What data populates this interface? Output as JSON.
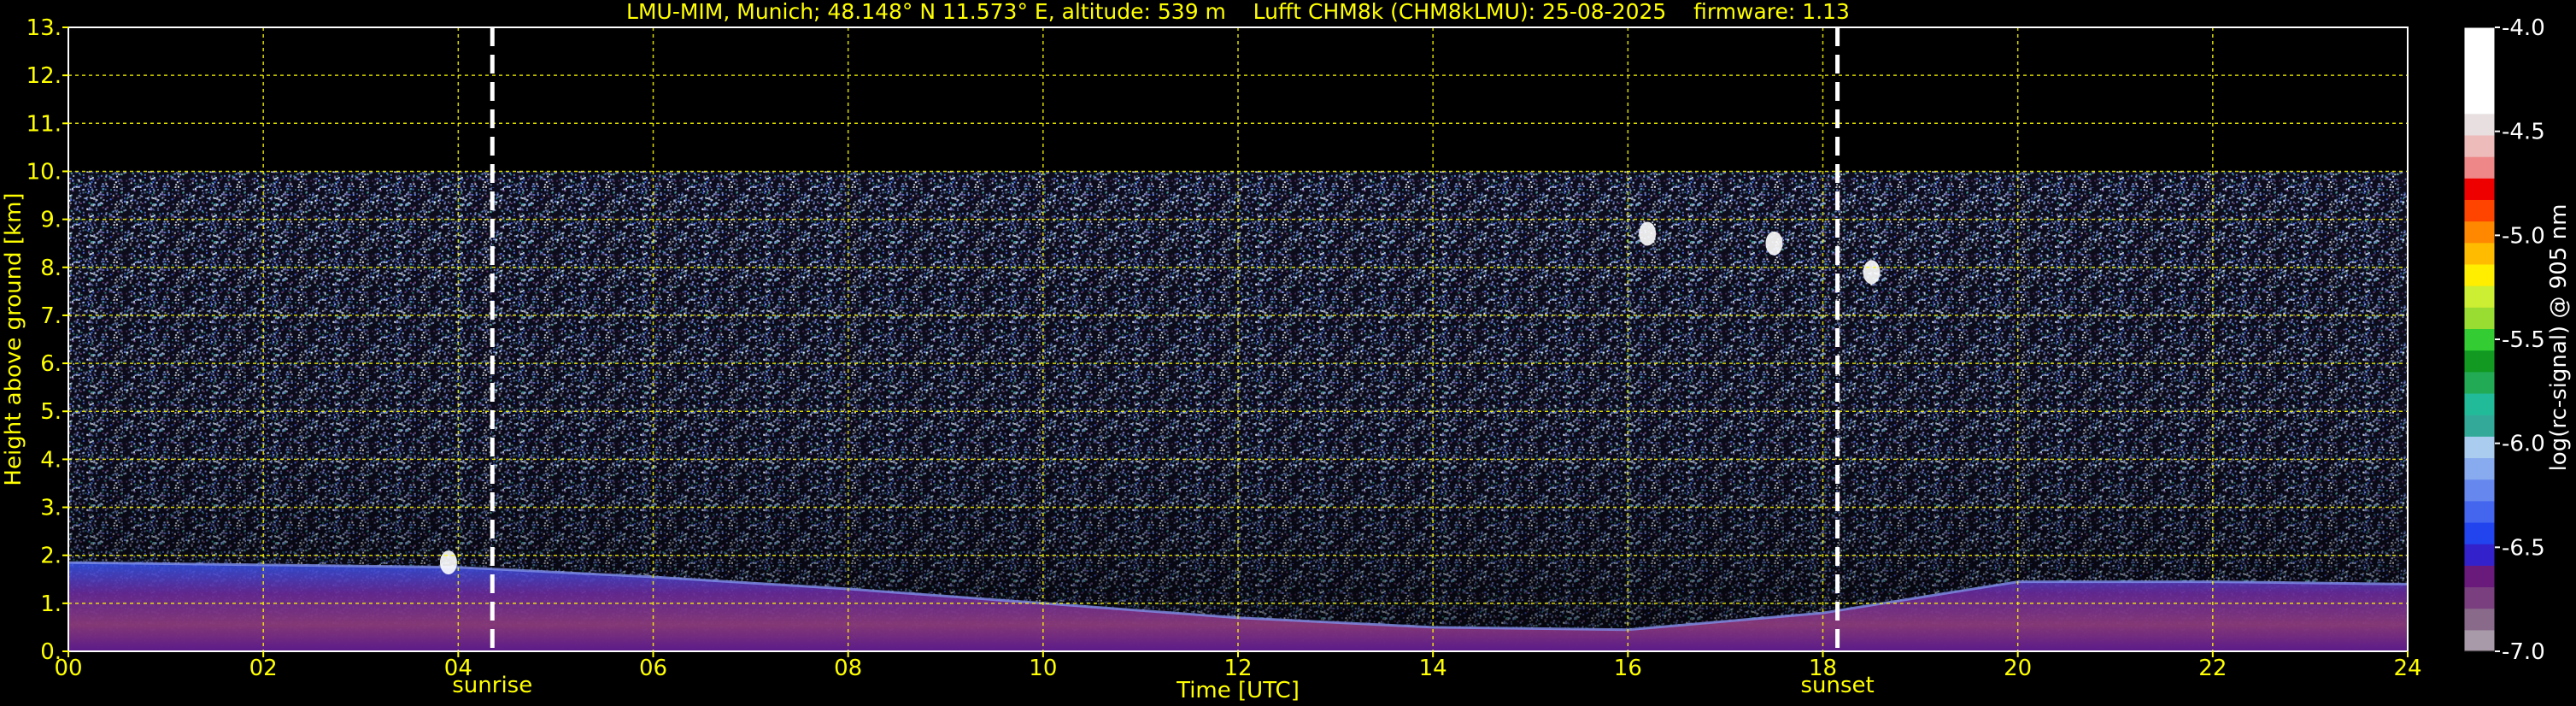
{
  "chart_data": {
    "type": "heatmap",
    "title": "LMU-MIM, Munich; 48.148° N 11.573° E, altitude: 539 m    Lufft CHM8k (CHM8kLMU): 25-08-2025    firmware: 1.13",
    "xlabel": "Time [UTC]",
    "ylabel": "Height above ground [km]",
    "xlim": [
      0,
      24
    ],
    "ylim": [
      0,
      13
    ],
    "x_ticks": [
      0,
      2,
      4,
      6,
      8,
      10,
      12,
      14,
      16,
      18,
      20,
      22,
      24
    ],
    "x_tick_labels": [
      "00",
      "02",
      "04",
      "06",
      "08",
      "10",
      "12",
      "14",
      "16",
      "18",
      "20",
      "22",
      "24"
    ],
    "y_ticks": [
      0,
      1,
      2,
      3,
      4,
      5,
      6,
      7,
      8,
      9,
      10,
      11,
      12,
      13
    ],
    "y_tick_labels": [
      "0.",
      "1.",
      "2.",
      "3.",
      "4.",
      "5.",
      "6.",
      "7.",
      "8.",
      "9.",
      "10.",
      "11.",
      "12.",
      "13."
    ],
    "grid": true,
    "data_top_km": 10.0,
    "markers": [
      {
        "label": "sunrise",
        "time": 4.35
      },
      {
        "label": "sunset",
        "time": 18.15
      }
    ],
    "boundary_layer_top_km": [
      [
        0,
        1.85
      ],
      [
        2,
        1.8
      ],
      [
        4,
        1.75
      ],
      [
        6,
        1.55
      ],
      [
        8,
        1.3
      ],
      [
        10,
        1.0
      ],
      [
        12,
        0.7
      ],
      [
        14,
        0.5
      ],
      [
        16,
        0.45
      ],
      [
        18,
        0.8
      ],
      [
        20,
        1.45
      ],
      [
        22,
        1.45
      ],
      [
        24,
        1.4
      ]
    ],
    "cloud_patches": [
      {
        "time": 3.9,
        "height_km": 1.85
      },
      {
        "time": 16.2,
        "height_km": 8.7
      },
      {
        "time": 17.5,
        "height_km": 8.5
      },
      {
        "time": 18.5,
        "height_km": 7.9
      }
    ],
    "colorbar": {
      "label": "log(rc-signal) @ 905 nm",
      "min": -7.0,
      "max": -4.0,
      "ticks": [
        -4.0,
        -4.5,
        -5.0,
        -5.5,
        -6.0,
        -6.5,
        -7.0
      ],
      "tick_labels": [
        "-4.0",
        "-4.5",
        "-5.0",
        "-5.5",
        "-6.0",
        "-6.5",
        "-7.0"
      ],
      "colors": [
        "#a89aa8",
        "#8a6a8a",
        "#7a3f7f",
        "#6a1a7a",
        "#3322cc",
        "#2244ee",
        "#4466ee",
        "#6688ee",
        "#88aaee",
        "#aaccee",
        "#33aa99",
        "#22bb99",
        "#22aa55",
        "#119922",
        "#33cc33",
        "#99dd33",
        "#ccee33",
        "#ffee00",
        "#ffbb00",
        "#ff8800",
        "#ff4400",
        "#ee0000",
        "#ee8888",
        "#eebbbb",
        "#e8e0e0",
        "#ffffff",
        "#ffffff",
        "#ffffff",
        "#ffffff"
      ]
    },
    "colors": {
      "text": "#ffff00",
      "grid": "#ffff00",
      "background": "#000000",
      "markers": "#ffffff",
      "colorbar_text": "#ffffff"
    }
  }
}
